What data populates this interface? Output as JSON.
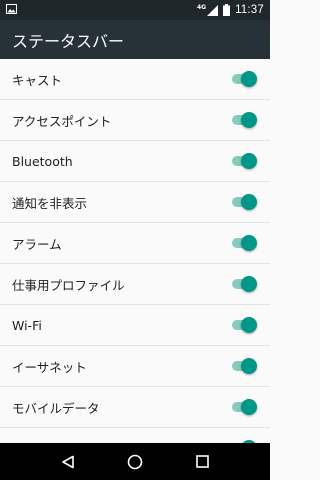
{
  "status_bar": {
    "network": "4G",
    "time": "11:37"
  },
  "app_bar": {
    "title": "ステータスバー"
  },
  "toggles": [
    {
      "label": "キャスト",
      "on": true
    },
    {
      "label": "アクセスポイント",
      "on": true
    },
    {
      "label": "Bluetooth",
      "on": true
    },
    {
      "label": "通知を非表示",
      "on": true
    },
    {
      "label": "アラーム",
      "on": true
    },
    {
      "label": "仕事用プロファイル",
      "on": true
    },
    {
      "label": "Wi-Fi",
      "on": true
    },
    {
      "label": "イーサネット",
      "on": true
    },
    {
      "label": "モバイルデータ",
      "on": true
    },
    {
      "label": "",
      "on": true
    }
  ],
  "colors": {
    "accent": "#009688",
    "track_on": "#87cbbd",
    "app_bar": "#263238",
    "status_bar": "#1f272b"
  },
  "nav": {
    "icons": [
      "back-icon",
      "home-icon",
      "recents-icon"
    ]
  }
}
